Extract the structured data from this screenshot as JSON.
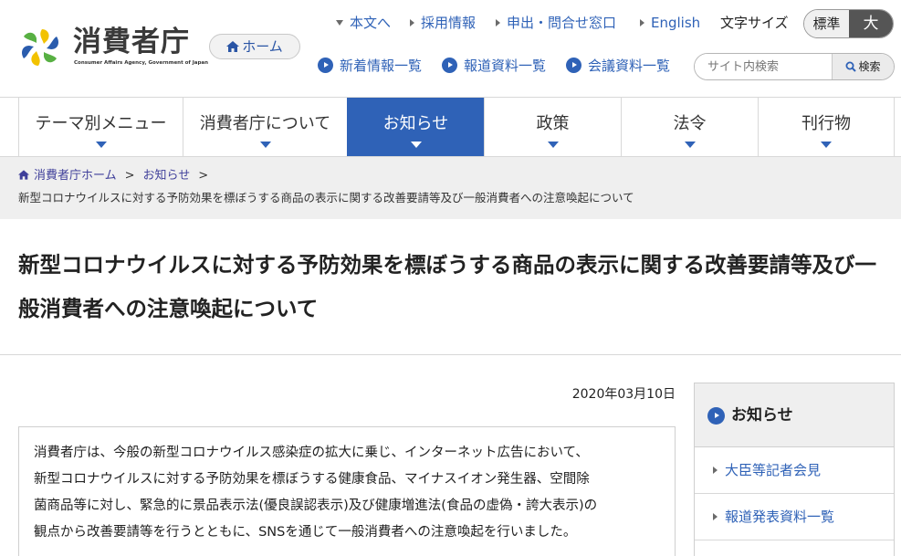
{
  "header": {
    "logo_title": "消費者庁",
    "logo_subtitle": "Consumer Affairs Agency, Government of Japan",
    "home_button": "ホーム",
    "top_links": [
      "本文へ",
      "採用情報",
      "申出・問合せ窓口",
      "English"
    ],
    "font_size_label": "文字サイズ",
    "font_size_standard": "標準",
    "font_size_large": "大",
    "sub_links": [
      "新着情報一覧",
      "報道資料一覧",
      "会議資料一覧"
    ],
    "search": {
      "placeholder": "サイト内検索",
      "button": "検索"
    }
  },
  "nav": {
    "items": [
      "テーマ別メニュー",
      "消費者庁について",
      "お知らせ",
      "政策",
      "法令",
      "刊行物"
    ],
    "active_index": 2
  },
  "breadcrumb": {
    "home": "消費者庁ホーム",
    "section": "お知らせ",
    "separator": ">",
    "current": "新型コロナウイルスに対する予防効果を標ぼうする商品の表示に関する改善要請等及び一般消費者への注意喚起について"
  },
  "page": {
    "title": "新型コロナウイルスに対する予防効果を標ぼうする商品の表示に関する改善要請等及び一般消費者への注意喚起について",
    "date": "2020年03月10日",
    "body_lines": [
      "消費者庁は、今般の新型コロナウイルス感染症の拡大に乗じ、インターネット広告において、",
      "新型コロナウイルスに対する予防効果を標ぼうする健康食品、マイナスイオン発生器、空間除",
      "菌商品等に対し、緊急的に景品表示法(優良誤認表示)及び健康増進法(食品の虚偽・誇大表示)の",
      "観点から改善要請等を行うとともに、SNSを通じて一般消費者への注意喚起を行いました。"
    ]
  },
  "sidebar": {
    "title": "お知らせ",
    "items": [
      "大臣等記者会見",
      "報道発表資料一覧"
    ]
  },
  "colors": {
    "primary_blue": "#2f62b7",
    "breadcrumb_bg": "#efefef",
    "logo_yellow": "#f2c200",
    "logo_blue": "#2a5cad",
    "logo_green": "#58b043"
  },
  "icons": {
    "home": "home-icon",
    "search": "search-icon",
    "link_arrow": "circle-arrow-icon"
  }
}
